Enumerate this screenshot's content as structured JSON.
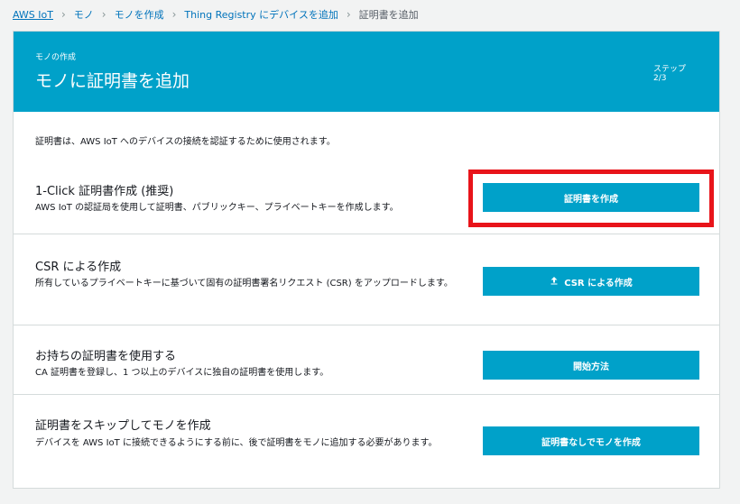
{
  "breadcrumb": {
    "items": [
      "AWS IoT",
      "モノ",
      "モノを作成",
      "Thing Registry にデバイスを追加"
    ],
    "current": "証明書を追加",
    "separator": "›"
  },
  "header": {
    "subtitle": "モノの作成",
    "title": "モノに証明書を追加",
    "step_label": "ステップ",
    "step_count": "2/3"
  },
  "intro": "証明書は、AWS IoT へのデバイスの接続を認証するために使用されます。",
  "options": [
    {
      "title": "1-Click 証明書作成 (推奨)",
      "desc": "AWS IoT の認証局を使用して証明書、パブリックキー、プライベートキーを作成します。",
      "button": "証明書を作成"
    },
    {
      "title": "CSR による作成",
      "desc": "所有しているプライベートキーに基づいて固有の証明書署名リクエスト (CSR) をアップロードします。",
      "button": "CSR による作成",
      "button_icon": "upload-icon"
    },
    {
      "title": "お持ちの証明書を使用する",
      "desc": "CA 証明書を登録し、1 つ以上のデバイスに独自の証明書を使用します。",
      "button": "開始方法"
    },
    {
      "title": "証明書をスキップしてモノを作成",
      "desc": "デバイスを AWS IoT に接続できるようにする前に、後で証明書をモノに追加する必要があります。",
      "button": "証明書なしでモノを作成"
    }
  ],
  "colors": {
    "accent": "#00a1c9",
    "link": "#0073bb",
    "highlight": "#e8141a"
  }
}
